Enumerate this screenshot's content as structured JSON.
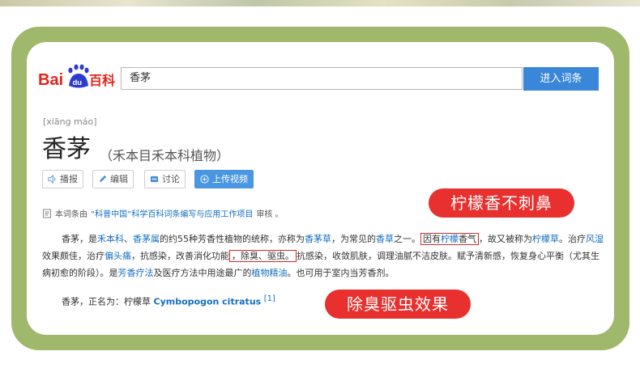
{
  "search": {
    "value": "香茅",
    "button": "进入词条"
  },
  "logo": {
    "text_left": "Bai",
    "text_paw": "du",
    "text_right": "百科"
  },
  "entry": {
    "pinyin": "[xiāng máo]",
    "title": "香茅",
    "subtitle": "（禾本目禾本科植物）"
  },
  "actions": [
    {
      "label": "播报",
      "icon": "speaker-icon"
    },
    {
      "label": "编辑",
      "icon": "pencil-icon"
    },
    {
      "label": "讨论",
      "icon": "chat-icon"
    },
    {
      "label": "上传视频",
      "icon": "plus-circle-icon"
    }
  ],
  "badges": {
    "top": "柠檬香不刺鼻",
    "bottom": "除臭驱虫效果"
  },
  "notice": {
    "pre": "本词条由",
    "link": "“科普中国”科学百科词条编写与应用工作项目",
    "post": " 审核 。"
  },
  "paragraph": {
    "s1": "香茅，是",
    "l1": "禾本科",
    "s2": "、",
    "l2": "香茅属",
    "s3": "的约55种芳香性植物的统称，亦称为",
    "l3": "香茅草",
    "s4": "，为常见的",
    "l4": "香草",
    "s5": "之一。",
    "box1_pre": "因有",
    "box1_link": "柠檬",
    "box1_post": "香气",
    "s6": "，故又被称为",
    "l5": "柠檬草",
    "s7": "。治疗",
    "l6": "风湿",
    "s8": "效果颇佳，治疗",
    "l7": "偏头痛",
    "s9": "，抗感染，改善消化功能",
    "box2": "，除臭、驱虫。",
    "s10": "抗感染，收敛肌肤，调理油腻不洁皮肤。赋予清新感，恢复身心平衡（尤其生病初愈的阶段）。是",
    "l8": "芳香疗法",
    "s11": "及医疗方法中用途最广的",
    "l9": "植物精油",
    "s12": "。也可用于室内当芳香剂。"
  },
  "formal": {
    "pre": "香茅，正名为：柠檬草 ",
    "latin": "Cymbopogon citratus",
    "ref": "[1]"
  },
  "colors": {
    "frame": "#9fb86c",
    "accent_blue": "#3a86d8",
    "link": "#136ec2",
    "badge_red": "#e8312f"
  }
}
